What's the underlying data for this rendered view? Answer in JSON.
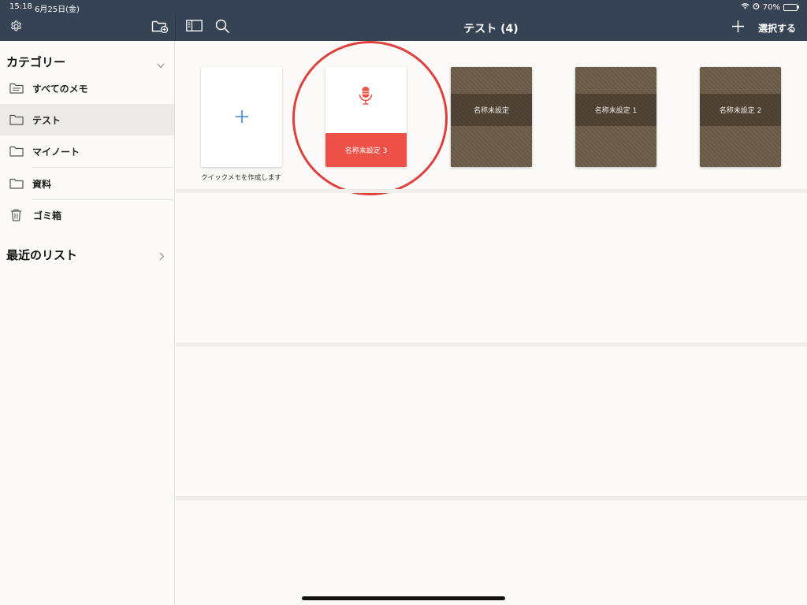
{
  "status_bar": {
    "time": "15:18",
    "date": "6月25日(金)",
    "battery_percent": "70%",
    "battery_level": 0.7
  },
  "header": {
    "title": "テスト (4)",
    "select_label": "選択する"
  },
  "icons": {
    "settings": "gear-icon",
    "new_folder": "folder-plus-icon",
    "sidebar_toggle": "sidebar-icon",
    "search": "search-icon",
    "add": "plus-icon"
  },
  "sidebar": {
    "categories_header": "カテゴリー",
    "items": [
      {
        "label": "すべてのメモ",
        "icon": "all-notes-folder-icon",
        "active": false
      },
      {
        "label": "テスト",
        "icon": "folder-icon",
        "active": true
      },
      {
        "label": "マイノート",
        "icon": "folder-icon",
        "active": false
      },
      {
        "label": "資料",
        "icon": "folder-icon",
        "active": false
      },
      {
        "label": "ゴミ箱",
        "icon": "trash-icon",
        "active": false
      }
    ],
    "recent_header": "最近のリスト"
  },
  "notes": {
    "quick_memo_caption": "クイックメモを作成します",
    "cards": [
      {
        "title": "名称未設定 3",
        "kind": "voice-memo"
      },
      {
        "title": "名称未設定",
        "kind": "notebook"
      },
      {
        "title": "名称未設定 1",
        "kind": "notebook"
      },
      {
        "title": "名称未設定 2",
        "kind": "notebook"
      }
    ]
  },
  "colors": {
    "header_bg": "#354355",
    "accent_blue": "#3d86cf",
    "voice_red": "#ee5148",
    "highlight_red": "#e0413e",
    "notebook_brown": "#6b5c48"
  }
}
